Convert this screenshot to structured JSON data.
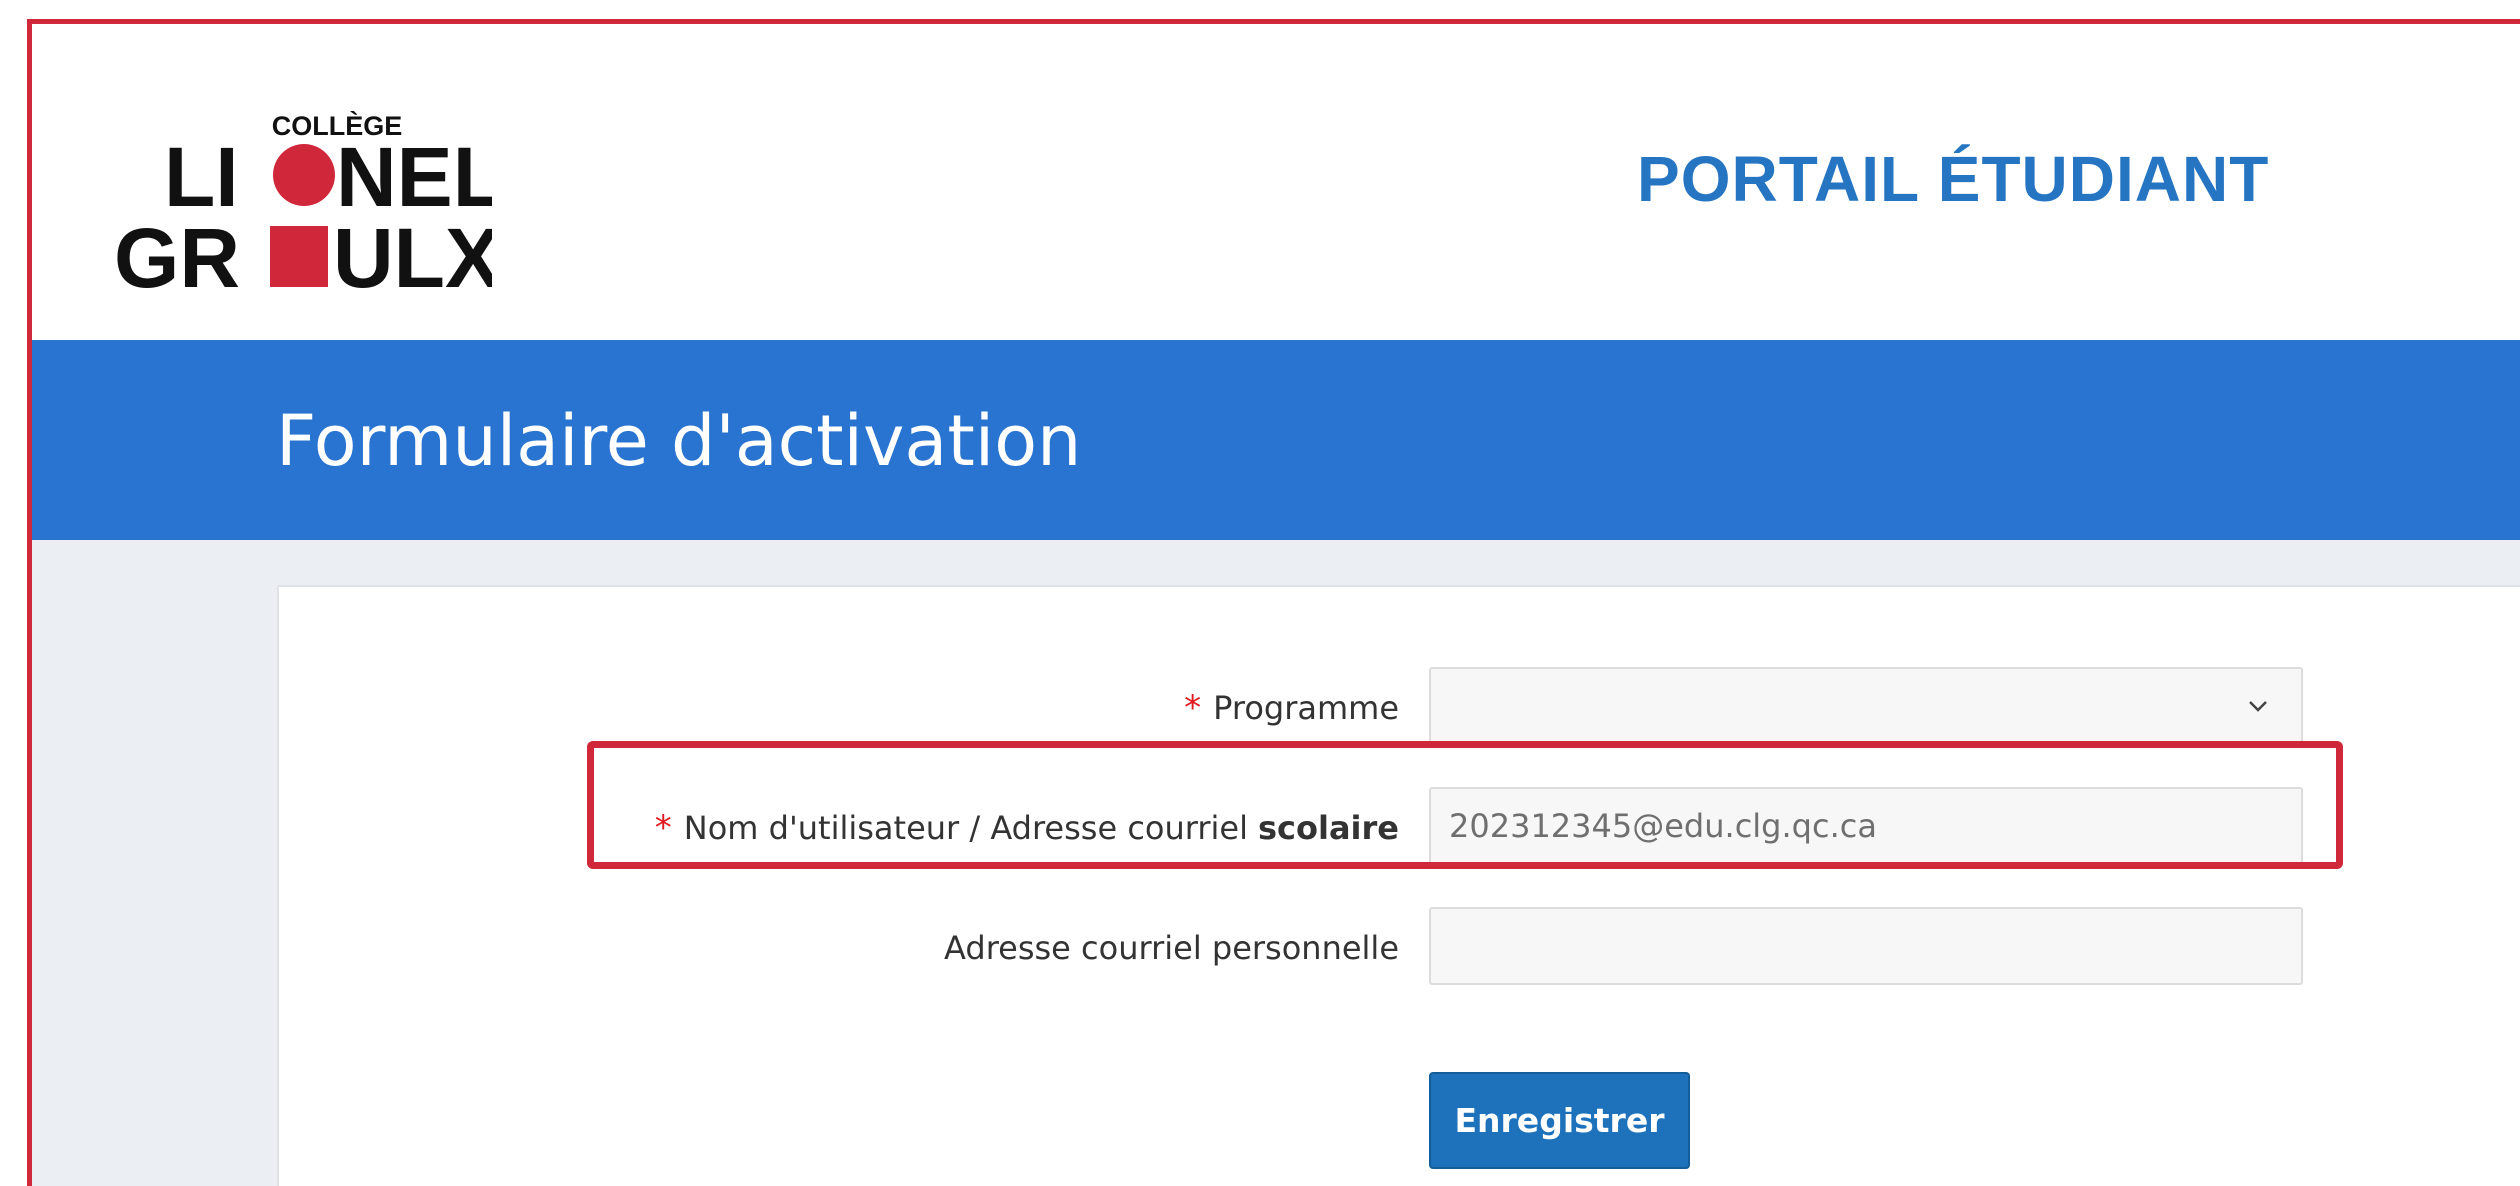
{
  "header": {
    "logo": {
      "top_text": "COLLÈGE",
      "line1": "LIONEL",
      "line2": "GROULX",
      "accent_color": "#d0283a"
    },
    "portal_title": "PORTAIL ÉTUDIANT"
  },
  "banner": {
    "title": "Formulaire d'activation",
    "color": "#2874d0"
  },
  "form": {
    "programme": {
      "required_mark": "*",
      "label": "Programme",
      "value": "",
      "icon": "chevron-down-icon"
    },
    "username": {
      "required_mark": "*",
      "label": "Nom d'utilisateur / Adresse courriel",
      "label_bold": "scolaire",
      "value": "202312345@edu.clg.qc.ca"
    },
    "personal_email": {
      "label": "Adresse courriel personnelle",
      "value": ""
    },
    "submit_label": "Enregistrer"
  },
  "annotation": {
    "highlight_color": "#d0283a"
  }
}
